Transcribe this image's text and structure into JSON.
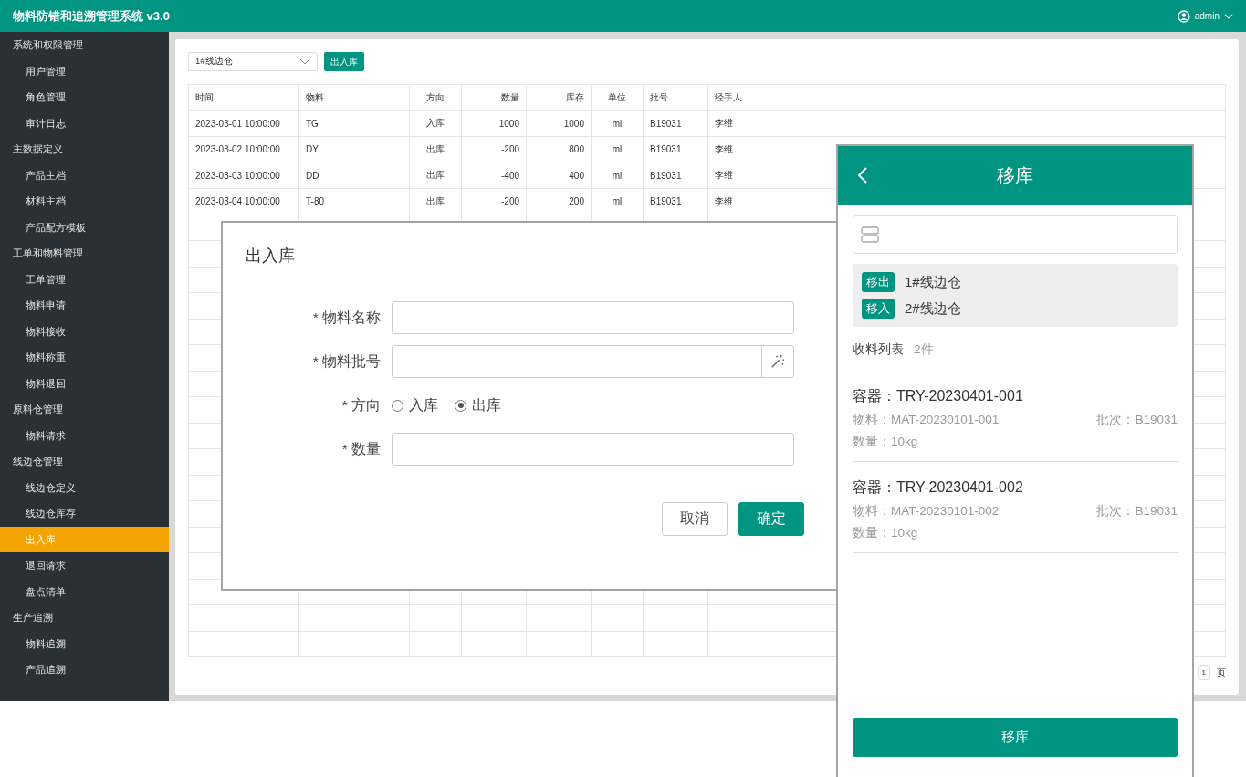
{
  "header": {
    "title": "物料防错和追溯管理系统 v3.0",
    "user": "admin"
  },
  "sidebar": {
    "items": [
      {
        "label": "系统和权限管理",
        "selected": false,
        "children": [
          {
            "label": "用户管理",
            "selected": false
          },
          {
            "label": "角色管理",
            "selected": false
          },
          {
            "label": "审计日志",
            "selected": false
          }
        ]
      },
      {
        "label": "主数据定义",
        "selected": false,
        "children": [
          {
            "label": "产品主档",
            "selected": false
          },
          {
            "label": "材料主档",
            "selected": false
          },
          {
            "label": "产品配方模板",
            "selected": false
          }
        ]
      },
      {
        "label": "工单和物料管理",
        "selected": false,
        "children": [
          {
            "label": "工单管理",
            "selected": false
          },
          {
            "label": "物料申请",
            "selected": false
          },
          {
            "label": "物料接收",
            "selected": false
          },
          {
            "label": "物料称重",
            "selected": false
          },
          {
            "label": "物料退回",
            "selected": false
          }
        ]
      },
      {
        "label": "原料仓管理",
        "selected": false,
        "children": [
          {
            "label": "物料请求",
            "selected": false
          }
        ]
      },
      {
        "label": "线边仓管理",
        "selected": false,
        "children": [
          {
            "label": "线边仓定义",
            "selected": false
          },
          {
            "label": "线边仓库存",
            "selected": false
          },
          {
            "label": "出入库",
            "selected": true
          },
          {
            "label": "退回请求",
            "selected": false
          },
          {
            "label": "盘点清单",
            "selected": false
          }
        ]
      },
      {
        "label": "生产追溯",
        "selected": false,
        "children": [
          {
            "label": "物料追溯",
            "selected": false
          },
          {
            "label": "产品追溯",
            "selected": false
          }
        ]
      }
    ]
  },
  "toolbar": {
    "warehouse_select": "1#线边仓",
    "button": "出入库"
  },
  "table": {
    "columns": [
      "时间",
      "物料",
      "方向",
      "数量",
      "库存",
      "单位",
      "批号",
      "经手人"
    ],
    "rows": [
      [
        "2023-03-01 10:00:00",
        "TG",
        "入库",
        "1000",
        "1000",
        "ml",
        "B19031",
        "李维"
      ],
      [
        "2023-03-02 10:00:00",
        "DY",
        "出库",
        "-200",
        "800",
        "ml",
        "B19031",
        "李维"
      ],
      [
        "2023-03-03 10:00:00",
        "DD",
        "出库",
        "-400",
        "400",
        "ml",
        "B19031",
        "李维"
      ],
      [
        "2023-03-04 10:00:00",
        "T-80",
        "出库",
        "-200",
        "200",
        "ml",
        "B19031",
        "李维"
      ]
    ]
  },
  "pagination": {
    "page": "1",
    "unit": "页"
  },
  "dialog": {
    "title": "出入库",
    "fields": [
      {
        "kind": "input",
        "label": "* 物料名称"
      },
      {
        "kind": "input-wand",
        "label": "* 物料批号"
      },
      {
        "kind": "radio",
        "label": "* 方向",
        "options": [
          {
            "label": "入库",
            "selected": false
          },
          {
            "label": "出库",
            "selected": true
          }
        ]
      },
      {
        "kind": "input",
        "label": "* 数量"
      }
    ],
    "buttons": [
      {
        "label": "取消",
        "kind": "secondary"
      },
      {
        "label": "确定",
        "kind": "primary"
      }
    ]
  },
  "mobile": {
    "title": "移库",
    "transfer": [
      {
        "tag": "移出",
        "warehouse": "1#线边仓"
      },
      {
        "tag": "移入",
        "warehouse": "2#线边仓"
      }
    ],
    "list_title": "收料列表",
    "list_count": "2件",
    "items": [
      {
        "container": "容器：TRY-20230401-001",
        "material": "物料：MAT-20230101-001",
        "batch": "批次：B19031",
        "quantity": "数量：10kg"
      },
      {
        "container": "容器：TRY-20230401-002",
        "material": "物料：MAT-20230101-002",
        "batch": "批次：B19031",
        "quantity": "数量：10kg"
      }
    ],
    "button": "移库"
  }
}
